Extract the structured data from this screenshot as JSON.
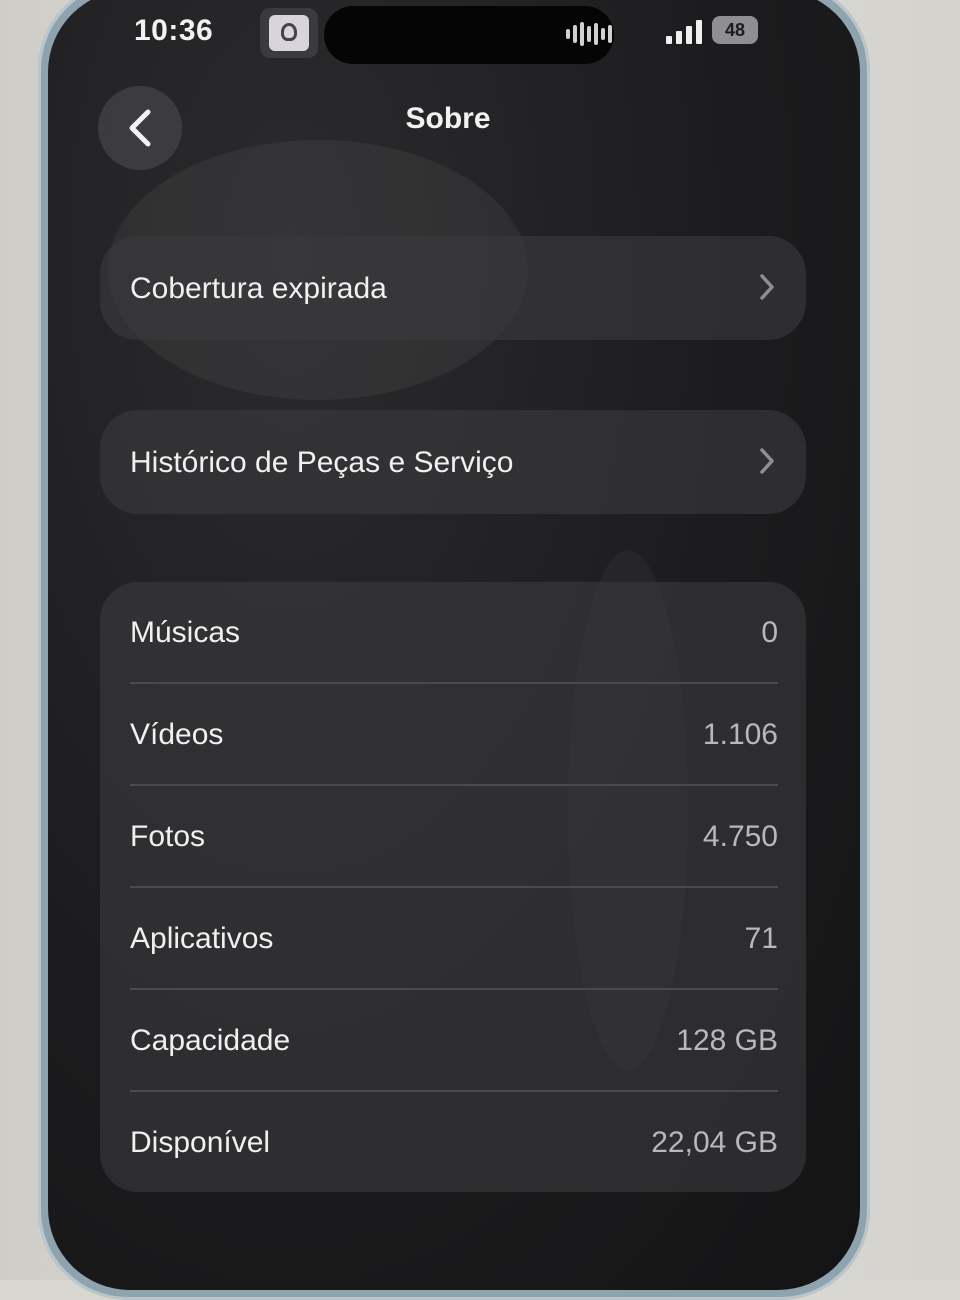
{
  "status_bar": {
    "time": "10:36",
    "battery": "48",
    "icons": [
      "app-notification-icon",
      "audio-waveform-icon",
      "cellular-signal-icon",
      "battery-icon"
    ]
  },
  "nav": {
    "title": "Sobre",
    "back_icon": "chevron-left-icon"
  },
  "links": [
    {
      "label": "Cobertura expirada",
      "icon": "chevron-right-icon"
    },
    {
      "label": "Histórico de Peças e Serviço",
      "icon": "chevron-right-icon"
    }
  ],
  "stats": [
    {
      "label": "Músicas",
      "value": "0"
    },
    {
      "label": "Vídeos",
      "value": "1.106"
    },
    {
      "label": "Fotos",
      "value": "4.750"
    },
    {
      "label": "Aplicativos",
      "value": "71"
    },
    {
      "label": "Capacidade",
      "value": "128 GB"
    },
    {
      "label": "Disponível",
      "value": "22,04 GB"
    }
  ],
  "colors": {
    "background": "#1c1c1e",
    "group": "#3a3a3e",
    "text": "#f0f0f0",
    "secondary_text": "#b8b8bc",
    "phone_frame": "#8fa3ae"
  }
}
